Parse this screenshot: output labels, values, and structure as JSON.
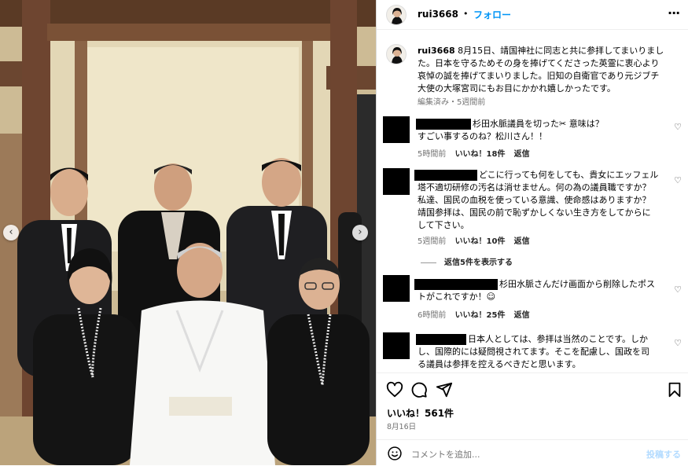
{
  "header": {
    "username": "rui3668",
    "separator": "•",
    "follow_label": "フォロー",
    "more_icon": "more-horizontal-icon"
  },
  "caption": {
    "username": "rui3668",
    "lines": [
      "8月15日、靖国神社に同志と共に参拝してまいりまし",
      "た。日本を守るためその身を捧げてくださった英霊に衷心より",
      "哀悼の誠を捧げてまいりました。旧知の自衛官であり元ジブチ",
      "大使の大塚宮司にもお目にかかれ嬉しかったです。"
    ],
    "meta": "編集済み・5週間前"
  },
  "comments": [
    {
      "lines": [
        "杉田水脈議員を切った✂︎ 意味は？",
        "すごい事するのね？松川さん！！"
      ],
      "time": "5時間前",
      "likes": "いいね！18件",
      "reply": "返信"
    },
    {
      "lines": [
        "どこに行っても何をしても、貴女にエッフェル",
        "塔不適切研修の汚名は消せません。何の為の議員職ですか？",
        "私達、国民の血税を使っている意識、使命感はありますか？",
        "靖国参拝は、国民の前で恥ずかしくない生き方をしてからに",
        "して下さい。"
      ],
      "time": "5週間前",
      "likes": "いいね！10件",
      "reply": "返信",
      "view_replies": "返信5件を表示する"
    },
    {
      "lines": [
        "杉田水脈さんだけ画面から削除したポス",
        "トがこれですか！☺︎"
      ],
      "time": "6時間前",
      "likes": "いいね！25件",
      "reply": "返信"
    },
    {
      "lines": [
        "日本人としては、参拝は当然のことです。しか",
        "し、国際的には疑問視されてます。そこを配慮し、国政を司",
        "る議員は参拝を控えるべきだと思います。"
      ],
      "time": "",
      "likes": "",
      "reply": ""
    }
  ],
  "actions": {
    "likes_count": "いいね！561件",
    "date": "8月16日"
  },
  "add_comment": {
    "placeholder": "コメントを追加...",
    "post_label": "投稿する"
  },
  "colors": {
    "accent": "#0095f6",
    "muted": "#737373"
  }
}
